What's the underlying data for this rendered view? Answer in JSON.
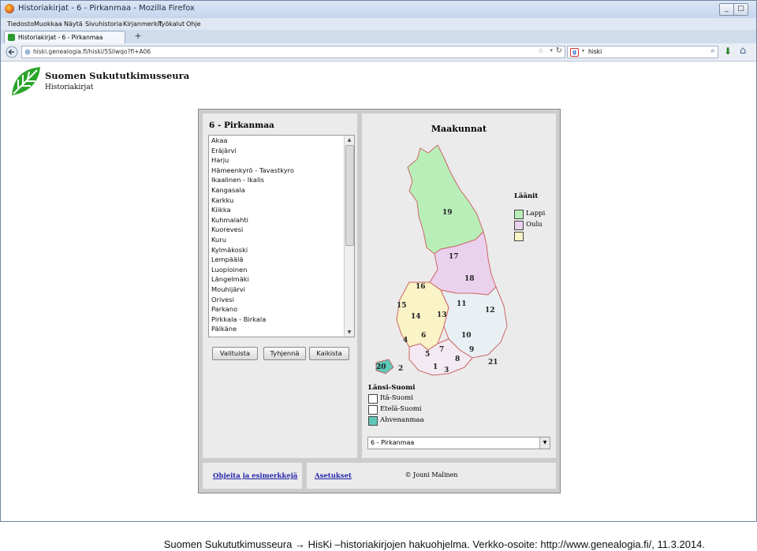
{
  "browser": {
    "window_title": "Historiakirjat - 6 - Pirkanmaa - Mozilla Firefox",
    "menu": [
      "Tiedosto",
      "Muokkaa",
      "Näytä",
      "Sivuhistoria",
      "Kirjanmerkit",
      "Työkalut",
      "Ohje"
    ],
    "tab_label": "Historiakirjat - 6 - Pirkanmaa",
    "new_tab": "+",
    "url": "hiski.genealogia.fi/hiski/5Sliwqo?fi+A06",
    "search_value": "hiski",
    "search_engine_letter": "g",
    "window_buttons": {
      "minimize": "_",
      "maximize": "□",
      "close": "✕"
    }
  },
  "site": {
    "name": "Suomen Sukututkimusseura",
    "subtitle": "Historiakirjat"
  },
  "left_panel": {
    "title": "6 - Pirkanmaa",
    "parishes": [
      "Akaa",
      "Eräjärvi",
      "Harju",
      "Hämeenkyrö - Tavastkyro",
      "Ikaalinen - Ikalis",
      "Kangasala",
      "Karkku",
      "Kiikka",
      "Kuhmalahti",
      "Kuorevesi",
      "Kuru",
      "Kylmäkoski",
      "Lempäälä",
      "Luopioinen",
      "Längelmäki",
      "Mouhijärvi",
      "Orivesi",
      "Parkano",
      "Pirkkala - Birkala",
      "Pälkäne"
    ],
    "buttons": {
      "select": "Valituista",
      "clear": "Tyhjennä",
      "all": "Kaikista"
    }
  },
  "right_panel": {
    "title": "Maakunnat",
    "laanit_title": "Läänit",
    "legend_top": [
      {
        "label": "Lappi",
        "color": "#b8efb8"
      },
      {
        "label": "Oulu",
        "color": "#ead1ee"
      },
      {
        "label": "",
        "color": "#f9f3c6"
      }
    ],
    "legend_bottom_title": "Länsi-Suomi",
    "legend_bottom": [
      {
        "label": "Itä-Suomi",
        "color": "#ffffff"
      },
      {
        "label": "Etelä-Suomi",
        "color": "#ffffff"
      },
      {
        "label": "Ahvenanmaa",
        "color": "#5ec9b8"
      }
    ],
    "region_numbers": [
      "19",
      "17",
      "18",
      "16",
      "15",
      "14",
      "13",
      "11",
      "12",
      "4",
      "6",
      "10",
      "5",
      "7",
      "8",
      "9",
      "20",
      "2",
      "1",
      "3",
      "21"
    ],
    "select_value": "6 - Pirkanmaa"
  },
  "bottom": {
    "help_link": "Ohjeita ja esimerkkejä",
    "settings_link": "Asetukset",
    "copyright": "© Jouni Malinen"
  },
  "caption": "Suomen Sukututkimusseura → HisKi –historiakirjojen hakuohjelma. Verkko-osoite: http://www.genealogia.fi/, 11.3.2014."
}
